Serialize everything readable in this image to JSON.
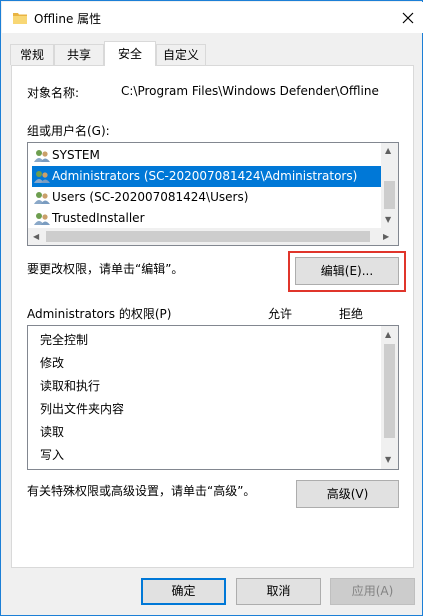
{
  "window": {
    "title": "Offline 属性"
  },
  "tabs": [
    {
      "label": "常规"
    },
    {
      "label": "共享"
    },
    {
      "label": "安全"
    },
    {
      "label": "自定义"
    }
  ],
  "object": {
    "label": "对象名称:",
    "value": "C:\\Program Files\\Windows Defender\\Offline"
  },
  "groups": {
    "label": "组或用户名(G):",
    "items": [
      {
        "name": "SYSTEM"
      },
      {
        "name": "Administrators (SC-202007081424\\Administrators)"
      },
      {
        "name": "Users (SC-202007081424\\Users)"
      },
      {
        "name": "TrustedInstaller"
      }
    ],
    "selected_index": 1
  },
  "edit": {
    "hint": "要更改权限，请单击“编辑”。",
    "button_label": "编辑(E)..."
  },
  "permissions": {
    "title": "Administrators 的权限(P)",
    "allow_header": "允许",
    "deny_header": "拒绝",
    "items": [
      {
        "name": "完全控制"
      },
      {
        "name": "修改"
      },
      {
        "name": "读取和执行"
      },
      {
        "name": "列出文件夹内容"
      },
      {
        "name": "读取"
      },
      {
        "name": "写入"
      }
    ]
  },
  "advanced": {
    "hint": "有关特殊权限或高级设置，请单击“高级”。",
    "button_label": "高级(V)"
  },
  "footer": {
    "ok_label": "确定",
    "cancel_label": "取消",
    "apply_label": "应用(A)"
  },
  "colors": {
    "selection": "#0078d7",
    "highlight_border": "#e0352b",
    "window_border": "#1c7fd6"
  }
}
